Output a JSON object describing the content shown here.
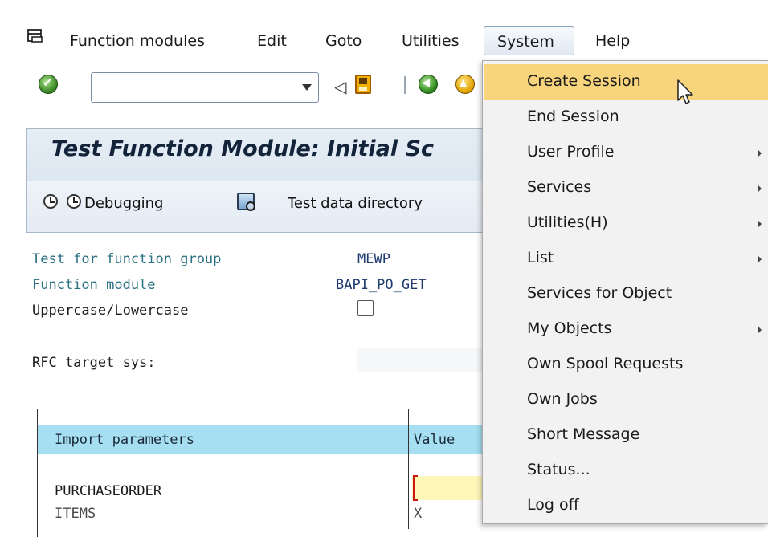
{
  "menubar": {
    "items": [
      {
        "label": "Function modules"
      },
      {
        "label": "Edit"
      },
      {
        "label": "Goto"
      },
      {
        "label": "Utilities"
      },
      {
        "label": "System"
      },
      {
        "label": "Help"
      }
    ]
  },
  "toolbar": {
    "command_field_value": "",
    "icons": [
      "ok-icon",
      "dropdown-arrow-icon",
      "back-triangle-icon",
      "save-icon",
      "nav-back-icon",
      "exit-icon"
    ]
  },
  "page": {
    "title": "Test Function Module: Initial Sc",
    "appbar": {
      "debugging_label": "Debugging",
      "test_data_directory_label": "Test data directory"
    }
  },
  "form": {
    "function_group_label": "Test for function group",
    "function_group_value": "MEWP",
    "function_module_label": "Function module",
    "function_module_value": "BAPI_PO_GET",
    "case_label": "Uppercase/Lowercase",
    "case_checked": false,
    "rfc_label": "RFC target sys:",
    "rfc_value": ""
  },
  "params_table": {
    "headers": [
      "Import parameters",
      "Value"
    ],
    "rows": [
      {
        "name": "PURCHASEORDER",
        "value": ""
      },
      {
        "name": "ITEMS",
        "value": "X"
      }
    ]
  },
  "system_menu": {
    "items": [
      {
        "label": "Create Session",
        "submenu": false,
        "highlighted": true
      },
      {
        "label": "End Session",
        "submenu": false,
        "highlighted": false
      },
      {
        "label": "User Profile",
        "submenu": true,
        "highlighted": false
      },
      {
        "label": "Services",
        "submenu": true,
        "highlighted": false
      },
      {
        "label": "Utilities(H)",
        "submenu": true,
        "highlighted": false
      },
      {
        "label": "List",
        "submenu": true,
        "highlighted": false
      },
      {
        "label": "Services for Object",
        "submenu": false,
        "highlighted": false
      },
      {
        "label": "My Objects",
        "submenu": true,
        "highlighted": false
      },
      {
        "label": "Own Spool Requests",
        "submenu": false,
        "highlighted": false
      },
      {
        "label": "Own Jobs",
        "submenu": false,
        "highlighted": false
      },
      {
        "label": "Short Message",
        "submenu": false,
        "highlighted": false
      },
      {
        "label": "Status...",
        "submenu": false,
        "highlighted": false
      },
      {
        "label": "Log off",
        "submenu": false,
        "highlighted": false
      }
    ]
  },
  "colors": {
    "highlight": "#f8d47c",
    "table_header": "#a6dff1",
    "title_panel": "#dfe8f1",
    "field_label_teal": "#2a6f82",
    "value_navy": "#1f3b6e"
  }
}
